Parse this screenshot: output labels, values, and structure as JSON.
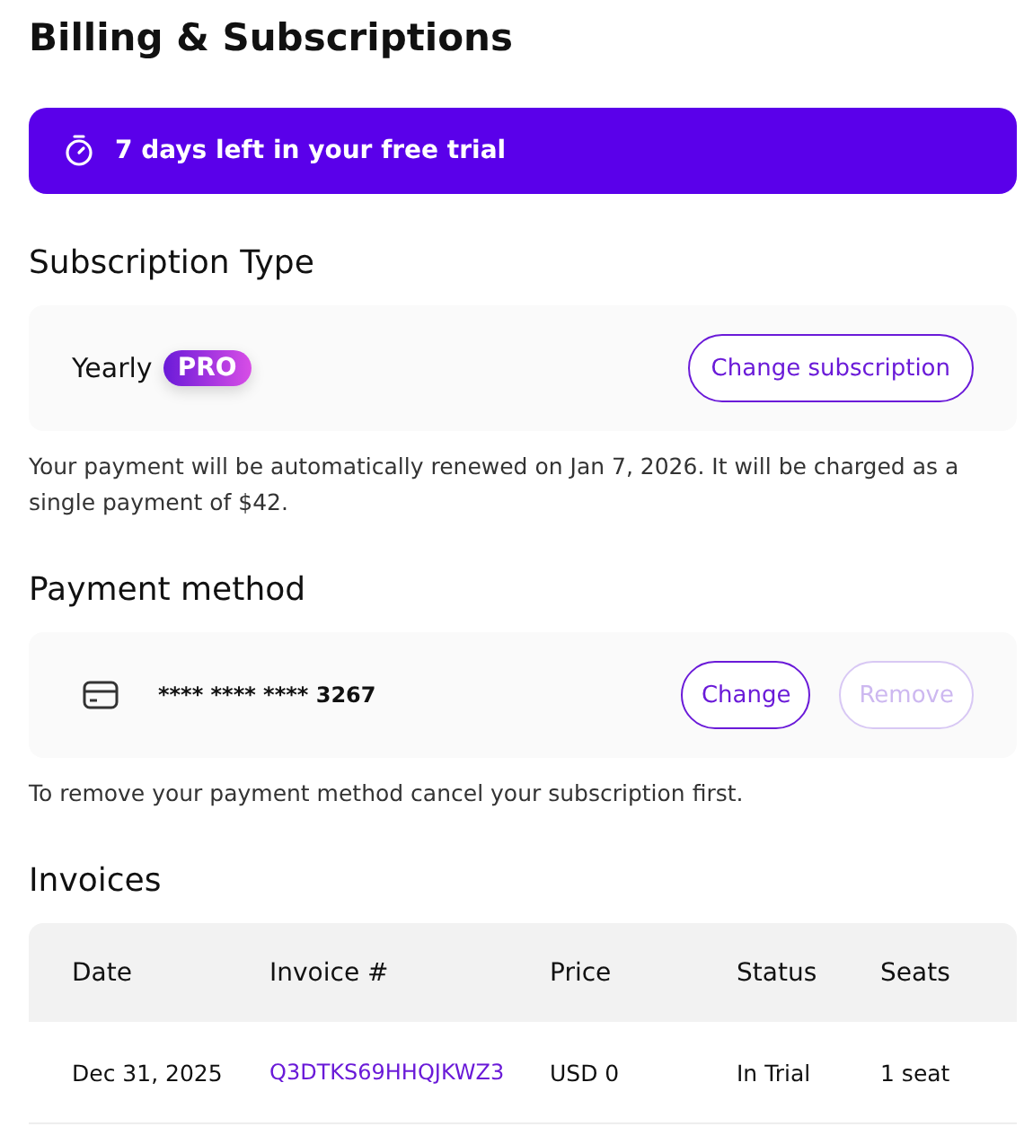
{
  "page": {
    "title": "Billing & Subscriptions"
  },
  "trial_banner": {
    "text": "7 days left in your free trial"
  },
  "subscription": {
    "heading": "Subscription Type",
    "plan": "Yearly",
    "badge": "PRO",
    "button": {
      "label": "Change subscription",
      "disabled": false
    },
    "note": "Your payment will be automatically renewed on Jan 7, 2026. It will be charged as a single payment of $42."
  },
  "payment": {
    "heading": "Payment method",
    "card_number": "**** **** **** 3267",
    "buttons": [
      {
        "label": "Change",
        "disabled": false
      },
      {
        "label": "Remove",
        "disabled": true
      }
    ],
    "note": "To remove your payment method cancel your subscription first."
  },
  "invoices": {
    "heading": "Invoices",
    "columns": [
      "Date",
      "Invoice #",
      "Price",
      "Status",
      "Seats"
    ],
    "rows": [
      {
        "cells": [
          {
            "text": "Dec 31, 2025",
            "kind": "text"
          },
          {
            "text": "Q3DTKS69HHQJKWZ3",
            "kind": "link"
          },
          {
            "text": "USD 0",
            "kind": "text"
          },
          {
            "text": "In Trial",
            "kind": "text"
          },
          {
            "text": "1 seat",
            "kind": "text"
          }
        ]
      }
    ]
  }
}
